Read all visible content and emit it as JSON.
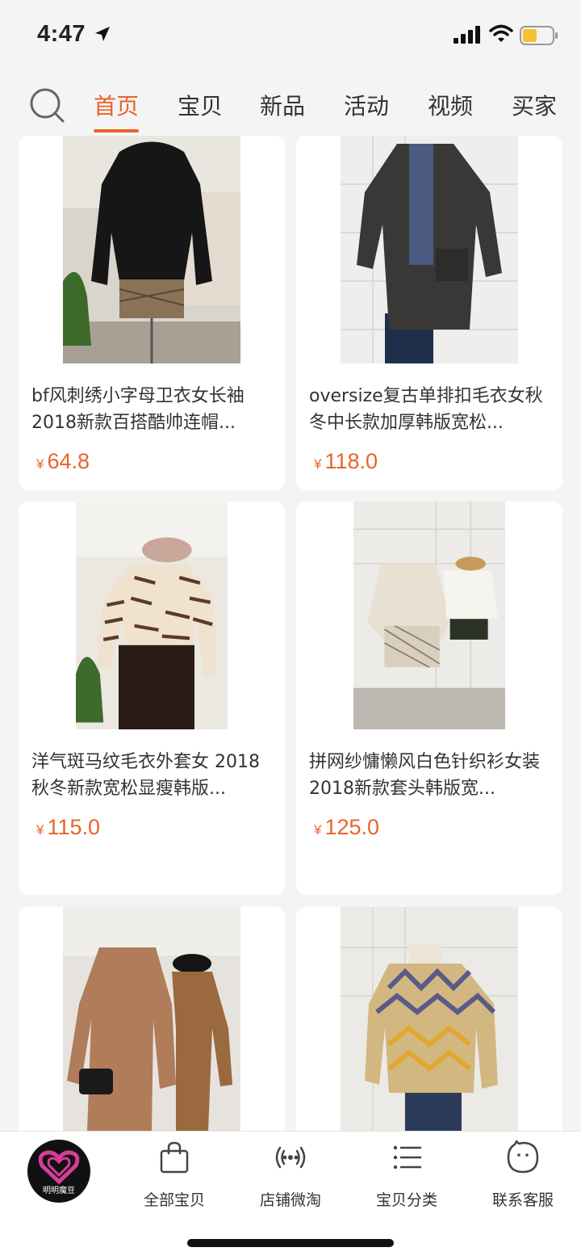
{
  "status_bar": {
    "time": "4:47"
  },
  "nav": {
    "tabs": [
      {
        "label": "首页",
        "active": true
      },
      {
        "label": "宝贝",
        "active": false
      },
      {
        "label": "新品",
        "active": false
      },
      {
        "label": "活动",
        "active": false
      },
      {
        "label": "视频",
        "active": false
      },
      {
        "label": "买家",
        "active": false
      }
    ]
  },
  "products": [
    {
      "title": "bf风刺绣小字母卫衣女长袖2018新款百搭酷帅连帽...",
      "currency": "¥",
      "price": "64.8"
    },
    {
      "title": "oversize复古单排扣毛衣女秋冬中长款加厚韩版宽松...",
      "currency": "¥",
      "price": "118.0"
    },
    {
      "title": "洋气斑马纹毛衣外套女 2018秋冬新款宽松显瘦韩版...",
      "currency": "¥",
      "price": "115.0"
    },
    {
      "title": "拼网纱慵懒风白色针织衫女装2018新款套头韩版宽...",
      "currency": "¥",
      "price": "125.0"
    },
    {
      "title": "",
      "currency": "",
      "price": ""
    },
    {
      "title": "",
      "currency": "",
      "price": ""
    }
  ],
  "bottom_bar": {
    "shop_logo_text": "明明魔豆",
    "items": [
      {
        "label": "全部宝贝",
        "icon": "bag-icon"
      },
      {
        "label": "店铺微淘",
        "icon": "broadcast-icon"
      },
      {
        "label": "宝贝分类",
        "icon": "list-icon"
      },
      {
        "label": "联系客服",
        "icon": "chat-face-icon"
      }
    ]
  },
  "colors": {
    "accent": "#e8632c",
    "background": "#f4f4f4"
  }
}
